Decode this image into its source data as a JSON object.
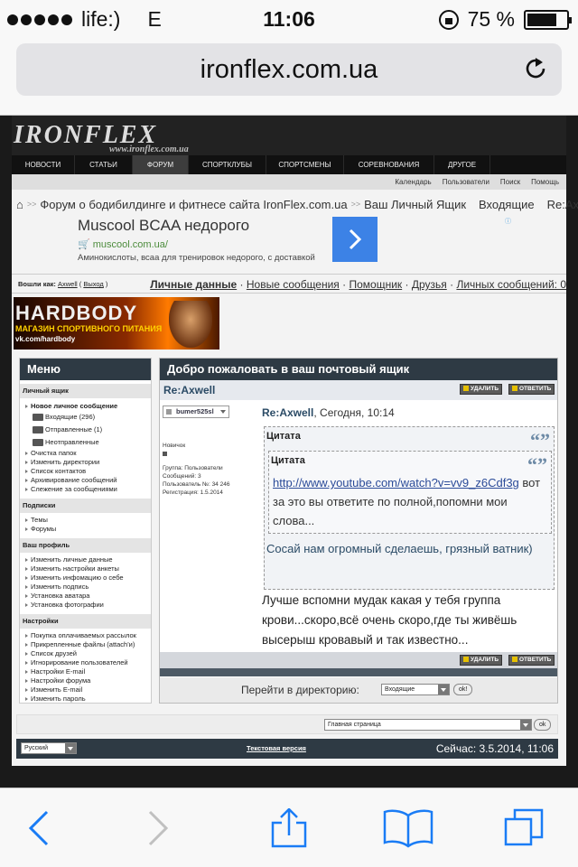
{
  "status": {
    "carrier": "life:)",
    "network": "E",
    "time": "11:06",
    "battery": "75 %",
    "battery_level": 0.75
  },
  "browser": {
    "url": "ironflex.com.ua"
  },
  "site": {
    "logo": "IRONFLEX",
    "logo_url": "www.ironflex.com.ua",
    "nav": [
      "НОВОСТИ",
      "СТАТЬИ",
      "ФОРУМ",
      "СПОРТКЛУБЫ",
      "СПОРТСМЕНЫ",
      "СОРЕВНОВАНИЯ",
      "ДРУГОЕ"
    ],
    "toplinks": [
      "Календарь",
      "Пользователи",
      "Поиск",
      "Помощь"
    ]
  },
  "breadcrumb": [
    "Форум о бодибилдинге и фитнесе сайта IronFlex.com.ua",
    "Ваш Личный Ящик",
    "Входящие",
    "Re:Axwell"
  ],
  "ad": {
    "title": "Muscool BCAA недорого",
    "url": "muscool.com.ua/",
    "desc": "Аминокислоты, всаа для тренировок недорого, с доставкой"
  },
  "userbar": {
    "logged_as": "Вошли как:",
    "user": "Axwell",
    "logout": "Выход",
    "links": [
      "Личные данные",
      "Новые сообщения",
      "Помощник",
      "Друзья",
      "Личных сообщений: 0"
    ]
  },
  "banner": {
    "title": "HARDBODY",
    "subtitle": "МАГАЗИН СПОРТИВНОГО ПИТАНИЯ",
    "link": "vk.com/hardbody"
  },
  "menu": {
    "title": "Меню",
    "sections": [
      {
        "title": "Личный ящик",
        "new_msg": "Новое личное сообщение",
        "folders": [
          "Входящие (296)",
          "Отправленные (1)",
          "Неотправленные"
        ],
        "items": [
          "Очистка папок",
          "Изменить директории",
          "Список контактов",
          "Архивирование сообщений",
          "Слежение за сообщениями"
        ]
      },
      {
        "title": "Подписки",
        "items": [
          "Темы",
          "Форумы"
        ]
      },
      {
        "title": "Ваш профиль",
        "items": [
          "Изменить личные данные",
          "Изменить настройки анкеты",
          "Изменить инфомацию о себе",
          "Изменить подпись",
          "Установка аватара",
          "Установка фотографии"
        ]
      },
      {
        "title": "Настройки",
        "items": [
          "Покупка оплачиваемых рассылок",
          "Прикрепленные файлы (attach'и)",
          "Список друзей",
          "Игнорирование пользователей",
          "Настройки E-mail",
          "Настройки форума",
          "Изменить E-mail",
          "Изменить пароль"
        ]
      }
    ]
  },
  "main": {
    "title": "Добро пожаловать в ваш почтовый ящик",
    "post_title": "Re:Axwell",
    "delete_btn": "УДАЛИТЬ",
    "reply_btn": "ОТВЕТИТЬ",
    "author": "bumer525sl",
    "subject": "Re:Axwell",
    "date": ", Сегодня, 10:14",
    "rank": "Новичок",
    "info": [
      "Группа: Пользователи",
      "Сообщений: 3",
      "Пользователь №: 34 246",
      "Регистрация: 1.5.2014"
    ],
    "quote_label": "Цитата",
    "inner_quote_link": "http://www.youtube.com/watch?v=vv9_z6Cdf3g",
    "inner_quote_text": " вот за это вы ответите по полной,попомни мои слова...",
    "outer_quote_text": "Сосай нам огромный сделаешь, грязный ватник)",
    "body": "Лучше вспомни мудак какая у тебя группа крови...скоро,всё очень скоро,где ты живёшь высерыш кровавый и так известно...",
    "goto_label": "Перейти в директорию:",
    "goto_value": "Входящие",
    "ok": "ok!"
  },
  "footer": {
    "home_select": "Главная страница",
    "ok": "ok",
    "lang": "Русский",
    "text_version": "Текстовая версия",
    "now": "Сейчас: 3.5.2014, 11:06"
  }
}
